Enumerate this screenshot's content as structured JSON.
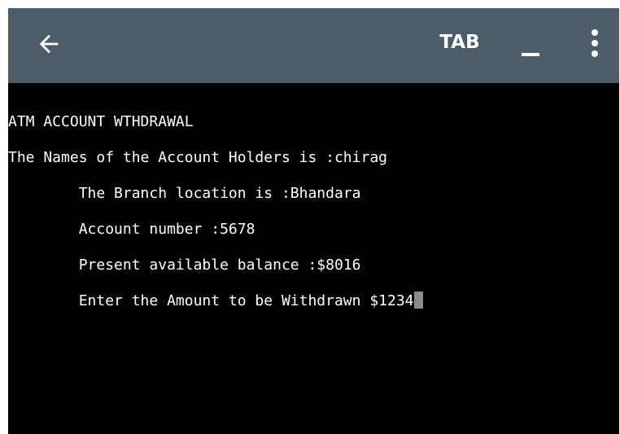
{
  "toolbar": {
    "back_icon": "arrow-left-icon",
    "tab_label": "TAB",
    "minimize_icon": "minimize-icon",
    "menu_icon": "more-vertical-icon",
    "background": "#4c5d69"
  },
  "terminal": {
    "background": "#000000",
    "text_color": "#ffffff",
    "lines": [
      "ATM ACCOUNT WTHDRAWAL",
      "The Names of the Account Holders is :chirag",
      "        The Branch location is :Bhandara",
      "        Account number :5678",
      "        Present available balance :$8016",
      "        Enter the Amount to be Withdrawn $1234"
    ],
    "cursor_color": "#8a8a8a"
  }
}
